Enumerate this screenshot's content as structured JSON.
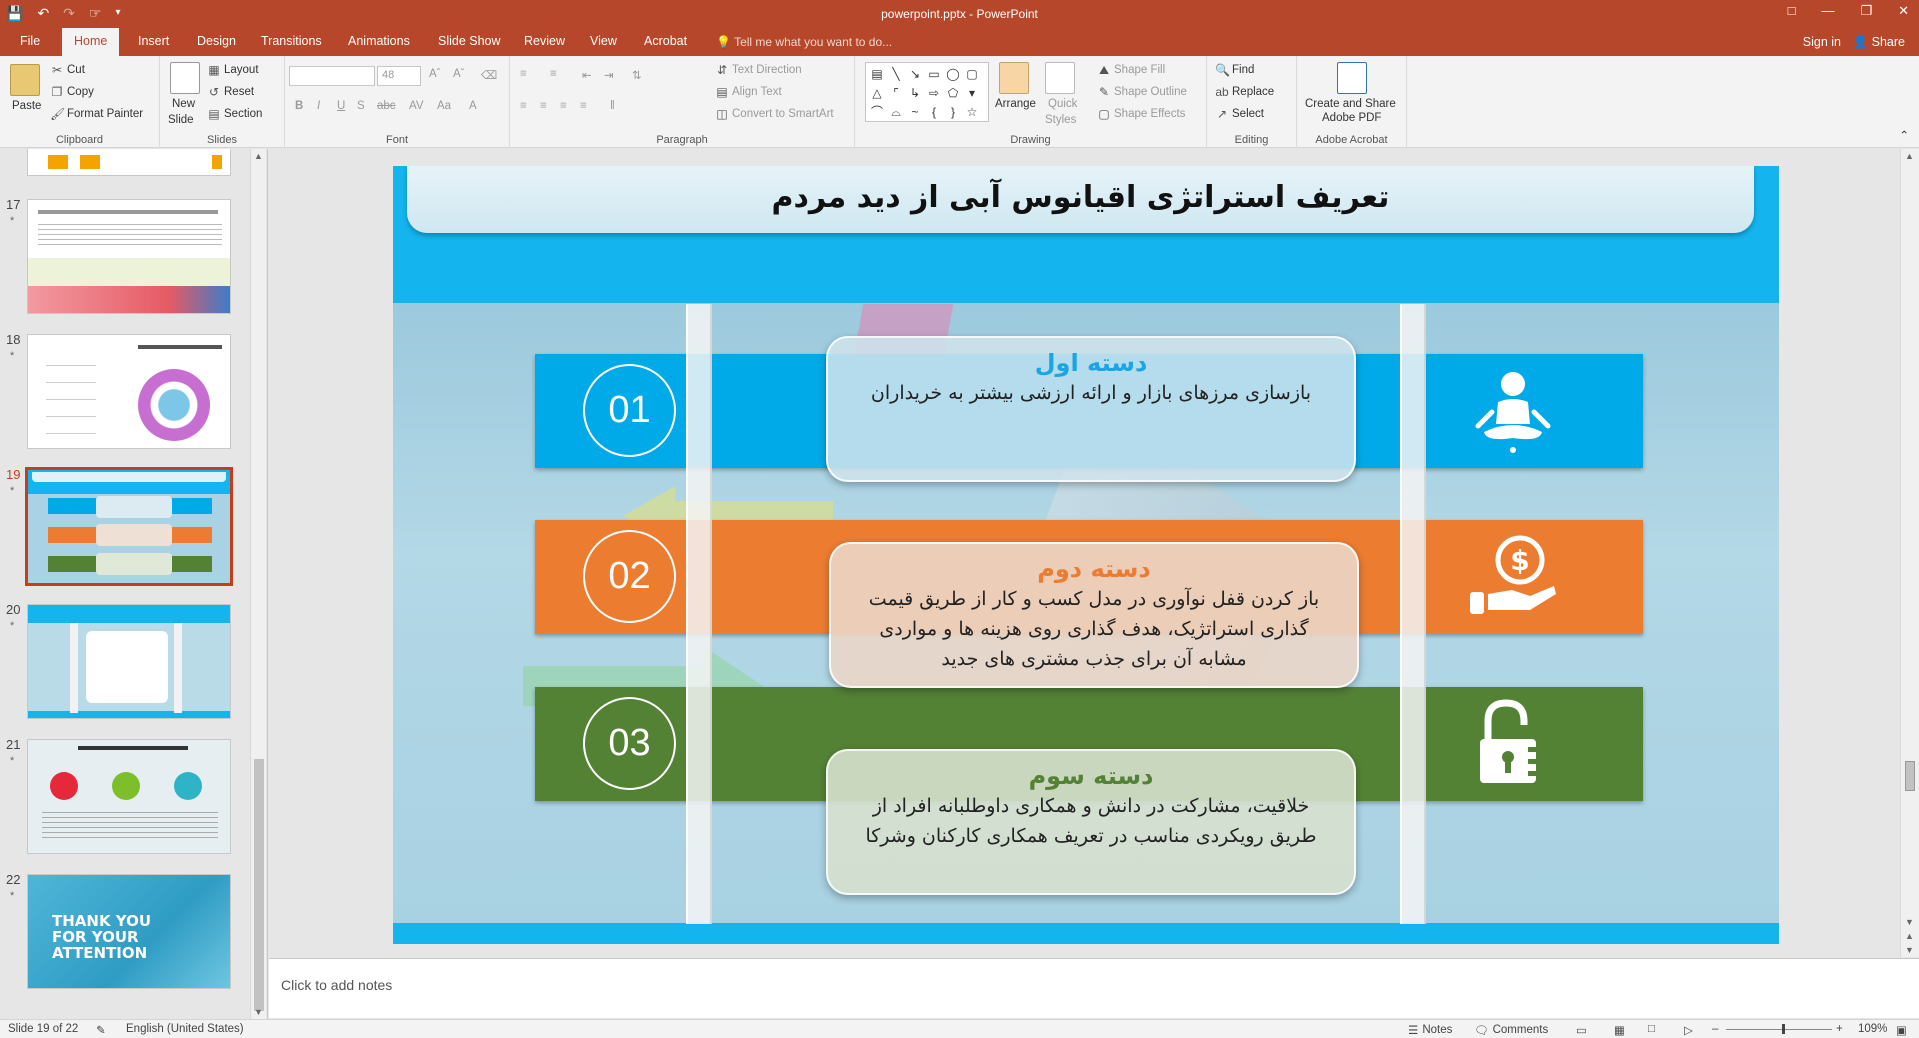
{
  "window": {
    "title": "powerpoint.pptx - PowerPoint",
    "qat_icons": [
      "save-icon",
      "undo-icon",
      "redo-icon",
      "touch-mode-icon",
      "customize-icon"
    ]
  },
  "tabs": [
    "File",
    "Home",
    "Insert",
    "Design",
    "Transitions",
    "Animations",
    "Slide Show",
    "Review",
    "View",
    "Acrobat"
  ],
  "active_tab": "Home",
  "tell_me": "Tell me what you want to do...",
  "account": {
    "signin": "Sign in",
    "share": "Share"
  },
  "ribbon": {
    "clipboard": {
      "label": "Clipboard",
      "paste": "Paste",
      "cut": "Cut",
      "copy": "Copy",
      "format_painter": "Format Painter"
    },
    "slides": {
      "label": "Slides",
      "new_slide_1": "New",
      "new_slide_2": "Slide",
      "layout": "Layout",
      "reset": "Reset",
      "section": "Section"
    },
    "font": {
      "label": "Font",
      "font_name": "",
      "font_size": "48"
    },
    "paragraph": {
      "label": "Paragraph",
      "text_direction": "Text Direction",
      "align_text": "Align Text",
      "convert_smartart": "Convert to SmartArt"
    },
    "drawing": {
      "label": "Drawing",
      "arrange": "Arrange",
      "quick_styles_1": "Quick",
      "quick_styles_2": "Styles",
      "shape_fill": "Shape Fill",
      "shape_outline": "Shape Outline",
      "shape_effects": "Shape Effects"
    },
    "editing": {
      "label": "Editing",
      "find": "Find",
      "replace": "Replace",
      "select": "Select"
    },
    "acrobat": {
      "label": "Adobe Acrobat",
      "create_1": "Create and Share",
      "create_2": "Adobe PDF"
    }
  },
  "thumbnails": [
    {
      "num": "17",
      "star": "*"
    },
    {
      "num": "18",
      "star": "*"
    },
    {
      "num": "19",
      "star": "*"
    },
    {
      "num": "20",
      "star": "*"
    },
    {
      "num": "21",
      "star": "*"
    },
    {
      "num": "22",
      "star": "*"
    }
  ],
  "thumb22_text": [
    "THANK YOU",
    "FOR YOUR",
    "ATTENTION"
  ],
  "slide": {
    "title": "تعریف استراتژی اقیانوس آبی از دید مردم",
    "rows": [
      {
        "num": "01",
        "heading": "دسته اول",
        "body": "بازسازی مرزهای بازار و ارائه ارزشی بیشتر به خریداران",
        "color": "#00a9e8",
        "card_bg": "rgba(206,226,236,0.88)",
        "heading_color": "#1aa6e3",
        "icon": "meditation-person-icon"
      },
      {
        "num": "02",
        "heading": "دسته دوم",
        "body": "باز کردن قفل نوآوری در مدل کسب و کار از طریق قیمت گذاری استراتژیک، هدف گذاری روی هزینه ها و مواردی مشابه آن برای جذب مشتری های جدید",
        "color": "#ec7c30",
        "card_bg": "rgba(235,214,200,0.9)",
        "heading_color": "#ec7c30",
        "icon": "money-hand-icon"
      },
      {
        "num": "03",
        "heading": "دسته سوم",
        "body": "خلاقیت، مشارکت در دانش و همکاری داوطلبانه افراد از طریق رویکردی مناسب در تعریف همکاری کارکنان وشرکا",
        "color": "#548235",
        "card_bg": "rgba(214,224,206,0.9)",
        "heading_color": "#548235",
        "icon": "unlocked-padlock-icon"
      }
    ]
  },
  "notes_placeholder": "Click to add notes",
  "status": {
    "slide_of": "Slide 19 of 22",
    "language": "English (United States)",
    "notes": "Notes",
    "comments": "Comments",
    "zoom": "109%"
  }
}
